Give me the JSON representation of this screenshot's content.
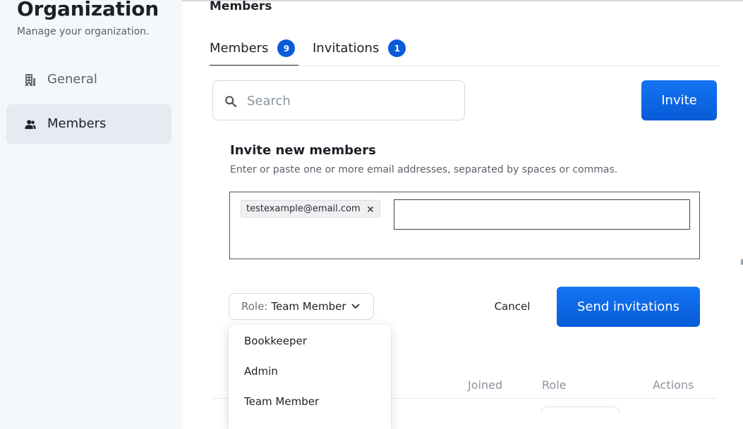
{
  "sidebar": {
    "title": "Organization",
    "subtitle": "Manage your organization.",
    "items": [
      {
        "label": "General",
        "icon": "building-icon",
        "active": false
      },
      {
        "label": "Members",
        "icon": "people-icon",
        "active": true
      }
    ]
  },
  "main": {
    "heading": "Members",
    "tabs": [
      {
        "label": "Members",
        "count": "9",
        "active": true
      },
      {
        "label": "Invitations",
        "count": "1",
        "active": false
      }
    ],
    "search": {
      "placeholder": "Search",
      "value": ""
    },
    "invite_button": "Invite"
  },
  "invite_panel": {
    "title": "Invite new members",
    "description": "Enter or paste one or more email addresses, separated by spaces or commas.",
    "emails": [
      "testexample@email.com"
    ],
    "email_input_value": "",
    "role": {
      "prefix": "Role:",
      "value": "Team Member",
      "options": [
        "Bookkeeper",
        "Admin",
        "Team Member"
      ]
    },
    "cancel_label": "Cancel",
    "send_label": "Send invitations"
  },
  "table": {
    "columns": [
      "Joined",
      "Role",
      "Actions"
    ]
  },
  "colors": {
    "accent": "#0a5bd8",
    "sidebar_bg": "#f4f7fc",
    "sidebar_active": "#e6eaf1"
  }
}
